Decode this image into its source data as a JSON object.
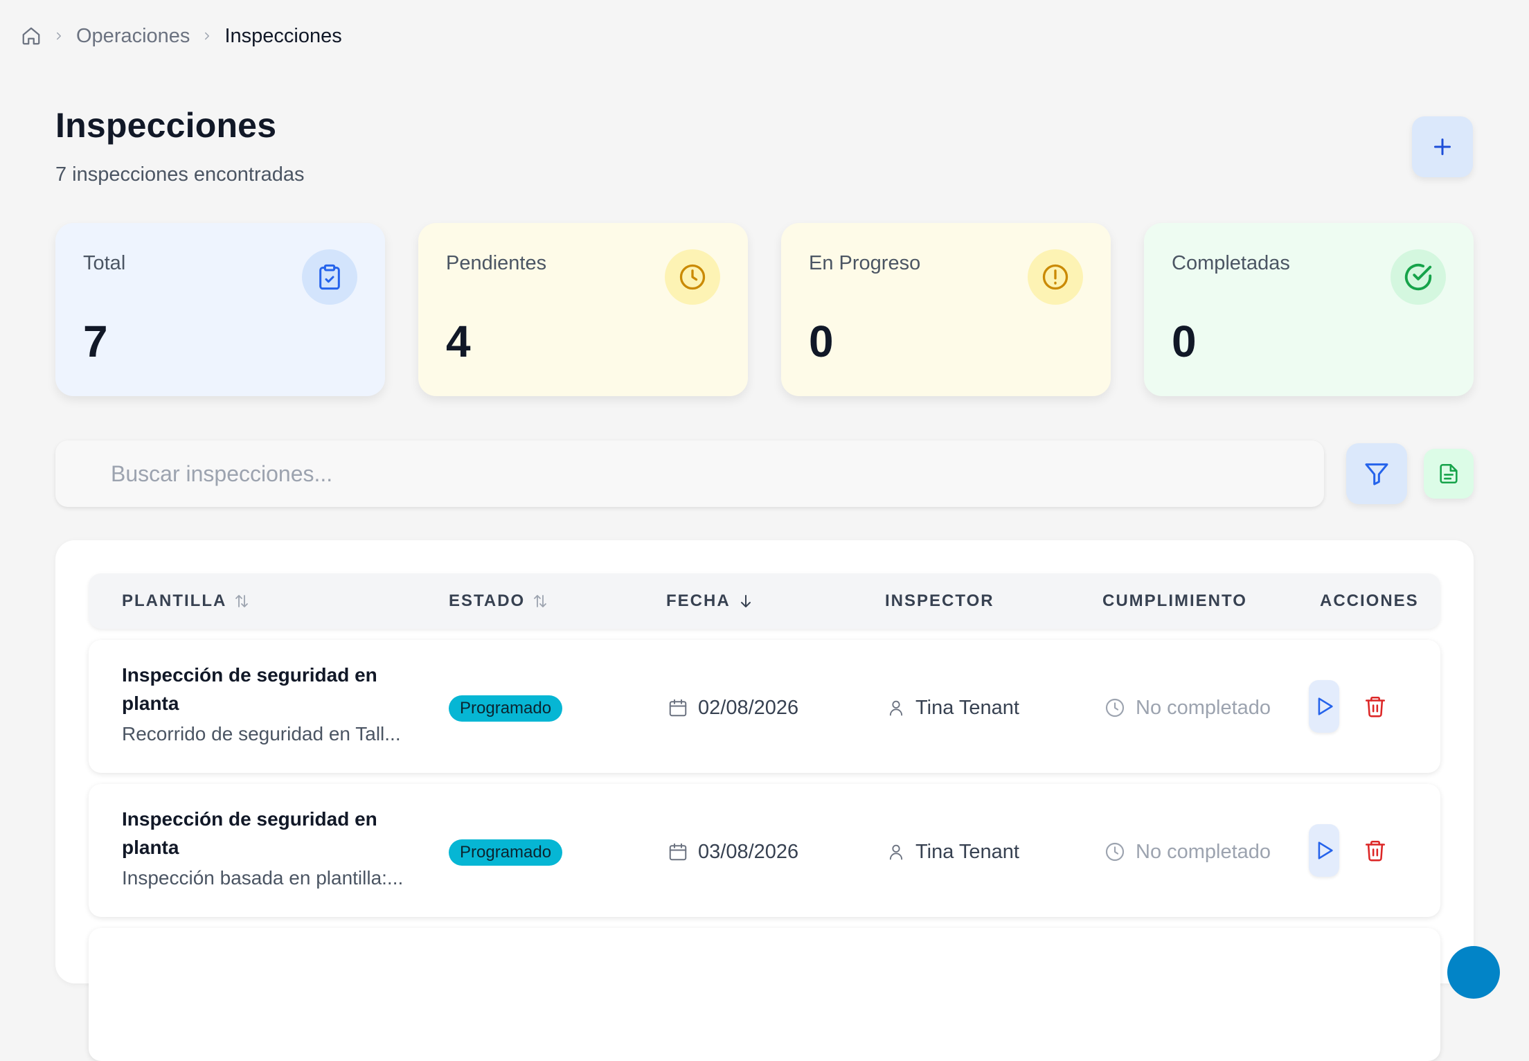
{
  "breadcrumb": {
    "items": [
      "Operaciones",
      "Inspecciones"
    ]
  },
  "header": {
    "title": "Inspecciones",
    "subtitle": "7 inspecciones encontradas"
  },
  "stats": [
    {
      "label": "Total",
      "value": "7",
      "icon": "clipboard-check-icon",
      "bg": "#eef4fe",
      "icon_bg": "#d3e4fc",
      "icon_color": "#2563eb"
    },
    {
      "label": "Pendientes",
      "value": "4",
      "icon": "clock-icon",
      "bg": "#fefbe8",
      "icon_bg": "#fdf3b4",
      "icon_color": "#ca8a04"
    },
    {
      "label": "En Progreso",
      "value": "0",
      "icon": "alert-circle-icon",
      "bg": "#fefbe8",
      "icon_bg": "#fdf3b4",
      "icon_color": "#ca8a04"
    },
    {
      "label": "Completadas",
      "value": "0",
      "icon": "check-circle-icon",
      "bg": "#eefcf2",
      "icon_bg": "#d4f7df",
      "icon_color": "#16a34a"
    }
  ],
  "search": {
    "placeholder": "Buscar inspecciones...",
    "value": ""
  },
  "table": {
    "columns": [
      "PLANTILLA",
      "ESTADO",
      "FECHA",
      "INSPECTOR",
      "CUMPLIMIENTO",
      "ACCIONES"
    ],
    "rows": [
      {
        "title": "Inspección de seguridad en planta",
        "description": "Recorrido de seguridad en Tall...",
        "status": "Programado",
        "date": "02/08/2026",
        "inspector": "Tina Tenant",
        "compliance": "No completado"
      },
      {
        "title": "Inspección de seguridad en planta",
        "description": "Inspección basada en plantilla:...",
        "status": "Programado",
        "date": "03/08/2026",
        "inspector": "Tina Tenant",
        "compliance": "No completado"
      }
    ]
  },
  "colors": {
    "accent": "#2563eb",
    "status_badge": "#06b6d4",
    "danger": "#dc2626",
    "success": "#16a34a"
  }
}
